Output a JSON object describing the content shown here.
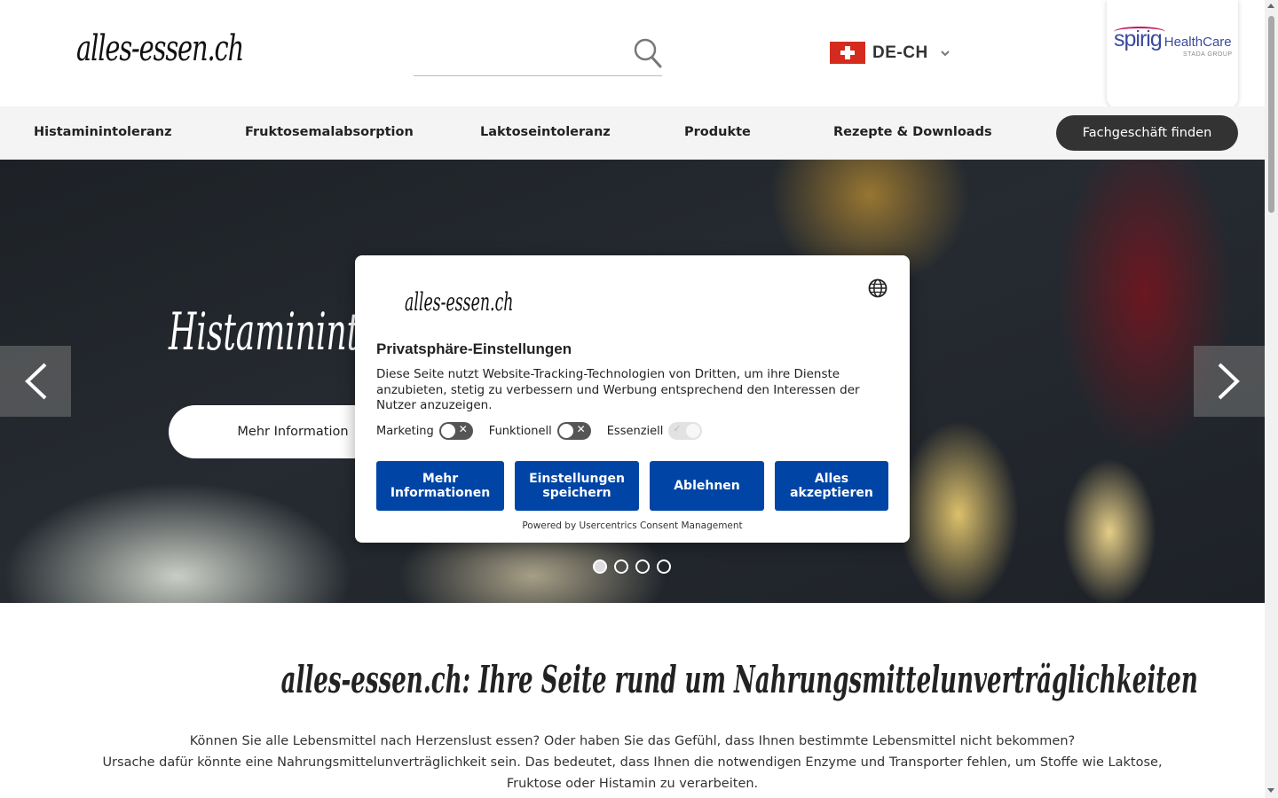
{
  "header": {
    "logo": "alles-essen.ch",
    "search": {
      "placeholder": "",
      "value": ""
    },
    "language": "DE-CH",
    "partner": {
      "brand": "spirig",
      "sub": "HealthCare",
      "group": "STADA GROUP"
    }
  },
  "nav": {
    "items": [
      "Histaminintoleranz",
      "Fruktosemalabsorption",
      "Laktoseintoleranz",
      "Produkte",
      "Rezepte & Downloads"
    ],
    "cta": "Fachgeschäft finden"
  },
  "hero": {
    "title": "Histaminintoleranz",
    "button": "Mehr Information",
    "slides": 4,
    "active_slide": 1
  },
  "intro": {
    "title": "alles-essen.ch: Ihre Seite rund um Nahrungsmittelunverträglichkeiten",
    "line1": "Können Sie alle Lebensmittel nach Herzenslust essen? Oder haben Sie das Gefühl, dass Ihnen bestimmte Lebensmittel nicht bekommen?",
    "line2": "Ursache dafür könnte eine Nahrungsmittelunverträglichkeit sein. Das bedeutet, dass Ihnen die notwendigen Enzyme und Transporter fehlen, um Stoffe wie Laktose, Fruktose oder Histamin zu verarbeiten."
  },
  "consent": {
    "logo": "alles-essen.ch",
    "title": "Privatsphäre-Einstellungen",
    "text": "Diese Seite nutzt Website-Tracking-Technologien von Dritten, um ihre Dienste anzubieten, stetig zu verbessern und Werbung entsprechend den Interessen der Nutzer anzuzeigen.",
    "toggles": [
      {
        "label": "Marketing",
        "enabled": false
      },
      {
        "label": "Funktionell",
        "enabled": false
      },
      {
        "label": "Essenziell",
        "enabled": true,
        "locked": true
      }
    ],
    "buttons": {
      "more": "Mehr Informationen",
      "save": "Einstellungen speichern",
      "deny": "Ablehnen",
      "accept": "Alles akzeptieren"
    },
    "powered": "Powered by Usercentrics Consent Management",
    "button_color": "#0045a5"
  }
}
